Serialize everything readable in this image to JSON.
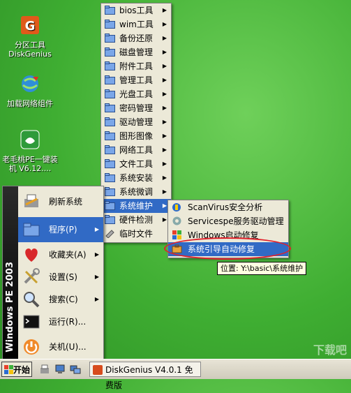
{
  "desktop": {
    "icons": [
      {
        "label": "分区工具\nDiskGenius",
        "icon": "diskgenius-icon"
      },
      {
        "label": "加载网络组件",
        "icon": "network-globe-icon"
      },
      {
        "label": "老毛桃PE一键装机 V6.12....",
        "icon": "laomaotao-icon"
      }
    ]
  },
  "menus": {
    "tools": [
      {
        "label": "bios工具",
        "arrow": "▶"
      },
      {
        "label": "wim工具",
        "arrow": "▶"
      },
      {
        "label": "备份还原",
        "arrow": "▶"
      },
      {
        "label": "磁盘管理",
        "arrow": "▶"
      },
      {
        "label": "附件工具",
        "arrow": "▶"
      },
      {
        "label": "管理工具",
        "arrow": "▶"
      },
      {
        "label": "光盘工具",
        "arrow": "▶"
      },
      {
        "label": "密码管理",
        "arrow": "▶"
      },
      {
        "label": "驱动管理",
        "arrow": "▶"
      },
      {
        "label": "图形图像",
        "arrow": "▶"
      },
      {
        "label": "网络工具",
        "arrow": "▶"
      },
      {
        "label": "文件工具",
        "arrow": "▶"
      },
      {
        "label": "系统安装",
        "arrow": "▶"
      },
      {
        "label": "系统微调",
        "arrow": "▶"
      },
      {
        "label": "系统维护",
        "arrow": "▶",
        "active": true
      },
      {
        "label": "硬件检测",
        "arrow": "▶"
      },
      {
        "label": "临时文件",
        "arrow": ""
      }
    ],
    "maintenance": [
      {
        "label": "ScanVirus安全分析"
      },
      {
        "label": "Servicespe服务驱动管理"
      },
      {
        "label": "Windows启动修复"
      },
      {
        "label": "系统引导自动修复",
        "active": true
      }
    ]
  },
  "start_menu": {
    "banner": "Windows PE 2003",
    "items": [
      {
        "label": "刷新系统",
        "arrow": ""
      },
      {
        "label": "程序(P)",
        "arrow": "▶",
        "active": true
      },
      {
        "label": "收藏夹(A)",
        "arrow": "▶"
      },
      {
        "label": "设置(S)",
        "arrow": "▶"
      },
      {
        "label": "搜索(C)",
        "arrow": "▶"
      },
      {
        "label": "运行(R)...",
        "arrow": ""
      },
      {
        "label": "关机(U)...",
        "arrow": ""
      }
    ]
  },
  "tooltip": "位置: Y:\\basic\\系统维护",
  "taskbar": {
    "start_label": "开始",
    "task_label": "DiskGenius V4.0.1 免费版"
  },
  "watermark": "下载吧",
  "colors": {
    "highlight": "#316ac5",
    "menu_bg": "#ece9d8",
    "ring": "#e0202a"
  }
}
